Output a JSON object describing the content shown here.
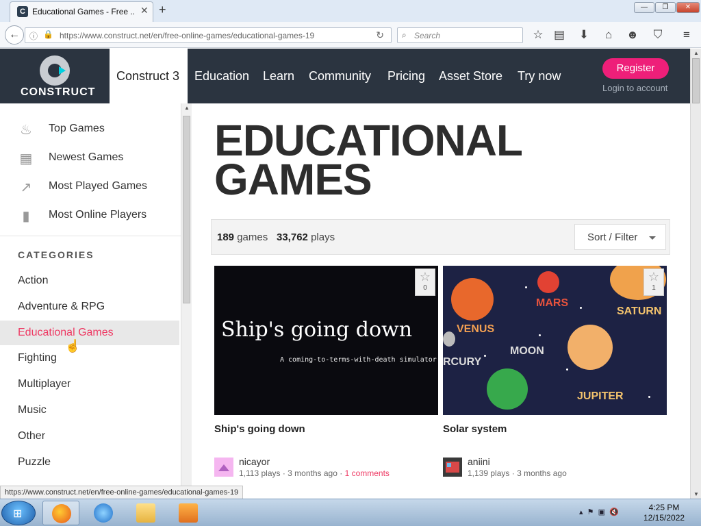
{
  "browser": {
    "tab_title": "Educational Games - Free ...",
    "tab_close": "✕",
    "new_tab": "+",
    "url": "https://www.construct.net/en/free-online-games/educational-games-19",
    "search_placeholder": "Search",
    "window_buttons": [
      "—",
      "❐",
      "✕"
    ],
    "status_url": "https://www.construct.net/en/free-online-games/educational-games-19"
  },
  "site": {
    "logo_text": "CONSTRUCT",
    "nav": [
      "Construct 3",
      "Education",
      "Learn",
      "Community",
      "Pricing",
      "Asset Store",
      "Try now"
    ],
    "register_label": "Register",
    "login_label": "Login to account",
    "accent_color": "#ee1f79"
  },
  "sidebar": {
    "links": [
      {
        "icon": "flame-icon",
        "label": "Top Games"
      },
      {
        "icon": "calendar-icon",
        "label": "Newest Games"
      },
      {
        "icon": "trending-up-icon",
        "label": "Most Played Games"
      },
      {
        "icon": "player-icon",
        "label": "Most Online Players"
      }
    ],
    "categories_heading": "CATEGORIES",
    "categories": [
      "Action",
      "Adventure & RPG",
      "Educational Games",
      "Fighting",
      "Multiplayer",
      "Music",
      "Other",
      "Puzzle"
    ],
    "active_category": "Educational Games"
  },
  "main": {
    "title_line1": "EDUCATIONAL",
    "title_line2": "GAMES",
    "games_count": "189",
    "games_label": "games",
    "plays_count": "33,762",
    "plays_label": "plays",
    "sort_label": "Sort / Filter",
    "cards": [
      {
        "title": "Ship's going down",
        "thumb_title": "Ship's going down",
        "thumb_subtitle": "A coming-to-terms-with-death simulator",
        "favorites": "0",
        "author": "nicayor",
        "plays": "1,113 plays",
        "age": "3 months ago",
        "comments": "1 comments"
      },
      {
        "title": "Solar system",
        "favorites": "1",
        "author": "aniini",
        "plays": "1,139 plays",
        "age": "3 months ago",
        "planet_labels": [
          "MARS",
          "VENUS",
          "SATURN",
          "MOON",
          "RCURY",
          "JUPITER"
        ]
      }
    ]
  },
  "taskbar": {
    "time": "4:25 PM",
    "date": "12/15/2022"
  }
}
